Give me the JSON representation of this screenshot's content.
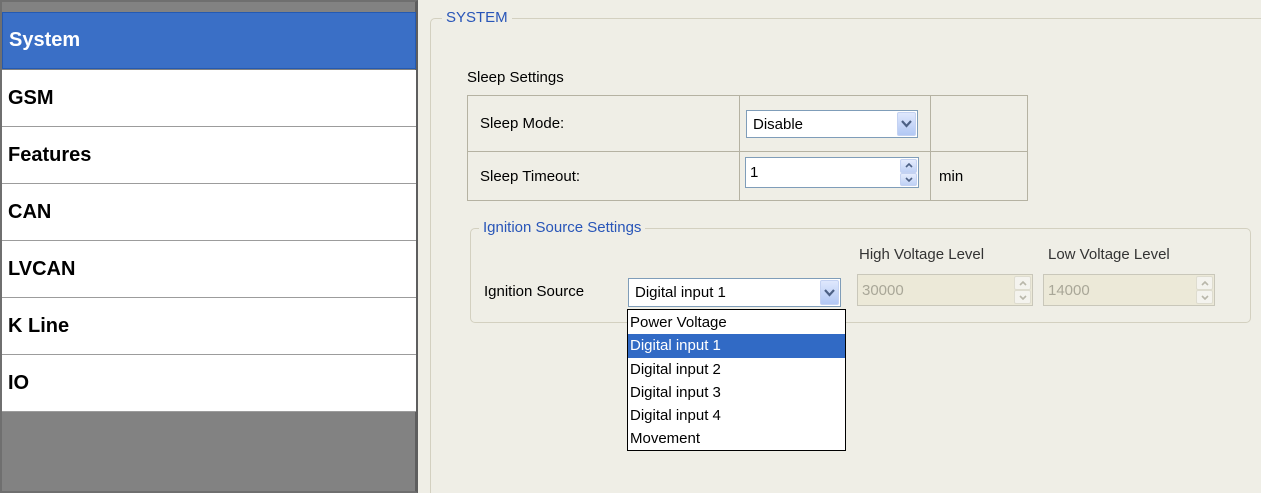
{
  "sidebar": {
    "items": [
      {
        "label": "System",
        "selected": true
      },
      {
        "label": "GSM",
        "selected": false
      },
      {
        "label": "Features",
        "selected": false
      },
      {
        "label": "CAN",
        "selected": false
      },
      {
        "label": "LVCAN",
        "selected": false
      },
      {
        "label": "K Line",
        "selected": false
      },
      {
        "label": "IO",
        "selected": false
      }
    ]
  },
  "system": {
    "group_title": "SYSTEM",
    "sleep_settings": {
      "title": "Sleep Settings",
      "sleep_mode_label": "Sleep Mode:",
      "sleep_mode_value": "Disable",
      "sleep_timeout_label": "Sleep Timeout:",
      "sleep_timeout_value": "1",
      "sleep_timeout_unit": "min"
    },
    "ignition": {
      "group_title": "Ignition Source Settings",
      "source_label": "Ignition Source",
      "source_value": "Digital input 1",
      "high_voltage_label": "High Voltage Level",
      "high_voltage_value": "30000",
      "low_voltage_label": "Low Voltage Level",
      "low_voltage_value": "14000",
      "options": [
        "Power Voltage",
        "Digital input 1",
        "Digital input 2",
        "Digital input 3",
        "Digital input 4",
        "Movement"
      ],
      "selected_option": "Digital input 1"
    }
  },
  "colors": {
    "selection": "#316ac5",
    "sidebar_selected": "#3a6fc6",
    "group_title": "#2855b8",
    "sidebar_bg": "#828282"
  },
  "icons": {
    "combo_arrow": "chevron-down-icon",
    "spin_up": "spin-up-icon",
    "spin_down": "spin-down-icon"
  }
}
